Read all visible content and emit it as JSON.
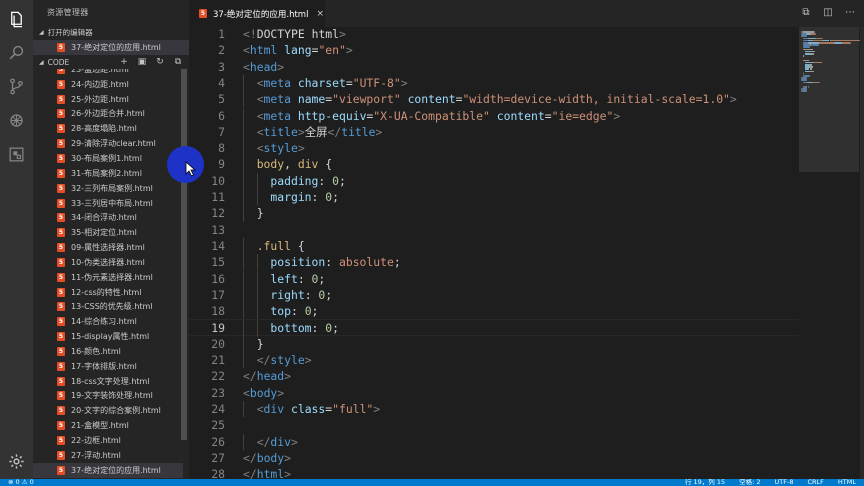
{
  "explorer": {
    "title": "资源管理器",
    "open_editors_label": "打开的编辑器",
    "open_editor_file": "37-绝对定位的应用.html",
    "folder_label": "CODE",
    "files": [
      {
        "name": "23-盒边距.html"
      },
      {
        "name": "24-内边距.html"
      },
      {
        "name": "25-外边距.html"
      },
      {
        "name": "26-外边距合并.html"
      },
      {
        "name": "28-高度塌陷.html"
      },
      {
        "name": "29-清除浮动clear.html"
      },
      {
        "name": "30-布局案例1.html"
      },
      {
        "name": "31-布局案例2.html"
      },
      {
        "name": "32-三列布局案例.html"
      },
      {
        "name": "33-三列居中布局.html"
      },
      {
        "name": "34-闭合浮动.html"
      },
      {
        "name": "35-相对定位.html"
      },
      {
        "name": "09-属性选择器.html"
      },
      {
        "name": "10-伪类选择器.html"
      },
      {
        "name": "11-伪元素选择器.html"
      },
      {
        "name": "12-css的特性.html"
      },
      {
        "name": "13-CSS的优先级.html"
      },
      {
        "name": "14-综合练习.html"
      },
      {
        "name": "15-display属性.html"
      },
      {
        "name": "16-颜色.html"
      },
      {
        "name": "17-字体排版.html"
      },
      {
        "name": "18-css文字处理.html"
      },
      {
        "name": "19-文字装饰处理.html"
      },
      {
        "name": "20-文字的综合案例.html"
      },
      {
        "name": "21-盒模型.html"
      },
      {
        "name": "22-边框.html"
      },
      {
        "name": "27-浮动.html"
      },
      {
        "name": "37-绝对定位的应用.html"
      }
    ],
    "active_file_index": 27
  },
  "tab": {
    "badge": "5",
    "label": "37-绝对定位的应用.html",
    "close": "×"
  },
  "editor": {
    "current_line": 19,
    "lines": [
      {
        "n": "1",
        "indent": 0,
        "tokens": [
          [
            "t-gray",
            "<!"
          ],
          [
            "t-white",
            "DOCTYPE html"
          ],
          [
            "t-gray",
            ">"
          ]
        ]
      },
      {
        "n": "2",
        "indent": 0,
        "tokens": [
          [
            "t-gray",
            "<"
          ],
          [
            "t-blue",
            "html"
          ],
          [
            "t-white",
            " "
          ],
          [
            "t-attr",
            "lang"
          ],
          [
            "t-white",
            "="
          ],
          [
            "t-str",
            "\"en\""
          ],
          [
            "t-gray",
            ">"
          ]
        ]
      },
      {
        "n": "3",
        "indent": 0,
        "tokens": [
          [
            "t-gray",
            "<"
          ],
          [
            "t-blue",
            "head"
          ],
          [
            "t-gray",
            ">"
          ]
        ]
      },
      {
        "n": "4",
        "indent": 1,
        "tokens": [
          [
            "t-gray",
            "<"
          ],
          [
            "t-blue",
            "meta"
          ],
          [
            "t-white",
            " "
          ],
          [
            "t-attr",
            "charset"
          ],
          [
            "t-white",
            "="
          ],
          [
            "t-str",
            "\"UTF-8\""
          ],
          [
            "t-gray",
            ">"
          ]
        ]
      },
      {
        "n": "5",
        "indent": 1,
        "tokens": [
          [
            "t-gray",
            "<"
          ],
          [
            "t-blue",
            "meta"
          ],
          [
            "t-white",
            " "
          ],
          [
            "t-attr",
            "name"
          ],
          [
            "t-white",
            "="
          ],
          [
            "t-str",
            "\"viewport\""
          ],
          [
            "t-white",
            " "
          ],
          [
            "t-attr",
            "content"
          ],
          [
            "t-white",
            "="
          ],
          [
            "t-str",
            "\"width=device-width, initial-scale=1.0\""
          ],
          [
            "t-gray",
            ">"
          ]
        ]
      },
      {
        "n": "6",
        "indent": 1,
        "tokens": [
          [
            "t-gray",
            "<"
          ],
          [
            "t-blue",
            "meta"
          ],
          [
            "t-white",
            " "
          ],
          [
            "t-attr",
            "http-equiv"
          ],
          [
            "t-white",
            "="
          ],
          [
            "t-str",
            "\"X-UA-Compatible\""
          ],
          [
            "t-white",
            " "
          ],
          [
            "t-attr",
            "content"
          ],
          [
            "t-white",
            "="
          ],
          [
            "t-str",
            "\"ie=edge\""
          ],
          [
            "t-gray",
            ">"
          ]
        ]
      },
      {
        "n": "7",
        "indent": 1,
        "tokens": [
          [
            "t-gray",
            "<"
          ],
          [
            "t-blue",
            "title"
          ],
          [
            "t-gray",
            ">"
          ],
          [
            "t-white",
            "全屏"
          ],
          [
            "t-gray",
            "</"
          ],
          [
            "t-blue",
            "title"
          ],
          [
            "t-gray",
            ">"
          ]
        ]
      },
      {
        "n": "8",
        "indent": 1,
        "tokens": [
          [
            "t-gray",
            "<"
          ],
          [
            "t-blue",
            "style"
          ],
          [
            "t-gray",
            ">"
          ]
        ]
      },
      {
        "n": "9",
        "indent": 1,
        "tokens": [
          [
            "t-sel",
            "body"
          ],
          [
            "t-white",
            ", "
          ],
          [
            "t-sel",
            "div"
          ],
          [
            "t-white",
            " {"
          ]
        ]
      },
      {
        "n": "10",
        "indent": 2,
        "tokens": [
          [
            "t-attr",
            "padding"
          ],
          [
            "t-white",
            ": "
          ],
          [
            "t-num",
            "0"
          ],
          [
            "t-white",
            ";"
          ]
        ]
      },
      {
        "n": "11",
        "indent": 2,
        "tokens": [
          [
            "t-attr",
            "margin"
          ],
          [
            "t-white",
            ": "
          ],
          [
            "t-num",
            "0"
          ],
          [
            "t-white",
            ";"
          ]
        ]
      },
      {
        "n": "12",
        "indent": 1,
        "tokens": [
          [
            "t-white",
            "}"
          ]
        ]
      },
      {
        "n": "13",
        "indent": 0,
        "tokens": []
      },
      {
        "n": "14",
        "indent": 1,
        "tokens": [
          [
            "t-sel",
            ".full"
          ],
          [
            "t-white",
            " {"
          ]
        ]
      },
      {
        "n": "15",
        "indent": 2,
        "tokens": [
          [
            "t-attr",
            "position"
          ],
          [
            "t-white",
            ": "
          ],
          [
            "t-str",
            "absolute"
          ],
          [
            "t-white",
            ";"
          ]
        ]
      },
      {
        "n": "16",
        "indent": 2,
        "tokens": [
          [
            "t-attr",
            "left"
          ],
          [
            "t-white",
            ": "
          ],
          [
            "t-num",
            "0"
          ],
          [
            "t-white",
            ";"
          ]
        ]
      },
      {
        "n": "17",
        "indent": 2,
        "tokens": [
          [
            "t-attr",
            "right"
          ],
          [
            "t-white",
            ": "
          ],
          [
            "t-num",
            "0"
          ],
          [
            "t-white",
            ";"
          ]
        ]
      },
      {
        "n": "18",
        "indent": 2,
        "tokens": [
          [
            "t-attr",
            "top"
          ],
          [
            "t-white",
            ": "
          ],
          [
            "t-num",
            "0"
          ],
          [
            "t-white",
            ";"
          ]
        ]
      },
      {
        "n": "19",
        "indent": 2,
        "tokens": [
          [
            "t-attr",
            "bottom"
          ],
          [
            "t-white",
            ": "
          ],
          [
            "t-num",
            "0"
          ],
          [
            "t-white",
            ";"
          ]
        ]
      },
      {
        "n": "20",
        "indent": 1,
        "tokens": [
          [
            "t-white",
            "}"
          ]
        ]
      },
      {
        "n": "21",
        "indent": 1,
        "tokens": [
          [
            "t-gray",
            "</"
          ],
          [
            "t-blue",
            "style"
          ],
          [
            "t-gray",
            ">"
          ]
        ]
      },
      {
        "n": "22",
        "indent": 0,
        "tokens": [
          [
            "t-gray",
            "</"
          ],
          [
            "t-blue",
            "head"
          ],
          [
            "t-gray",
            ">"
          ]
        ]
      },
      {
        "n": "23",
        "indent": 0,
        "tokens": [
          [
            "t-gray",
            "<"
          ],
          [
            "t-blue",
            "body"
          ],
          [
            "t-gray",
            ">"
          ]
        ]
      },
      {
        "n": "24",
        "indent": 1,
        "tokens": [
          [
            "t-gray",
            "<"
          ],
          [
            "t-blue",
            "div"
          ],
          [
            "t-white",
            " "
          ],
          [
            "t-attr",
            "class"
          ],
          [
            "t-white",
            "="
          ],
          [
            "t-str",
            "\"full\""
          ],
          [
            "t-gray",
            ">"
          ]
        ]
      },
      {
        "n": "25",
        "indent": 0,
        "tokens": []
      },
      {
        "n": "26",
        "indent": 1,
        "tokens": [
          [
            "t-gray",
            "</"
          ],
          [
            "t-blue",
            "div"
          ],
          [
            "t-gray",
            ">"
          ]
        ]
      },
      {
        "n": "27",
        "indent": 0,
        "tokens": [
          [
            "t-gray",
            "</"
          ],
          [
            "t-blue",
            "body"
          ],
          [
            "t-gray",
            ">"
          ]
        ]
      },
      {
        "n": "28",
        "indent": 0,
        "tokens": [
          [
            "t-gray",
            "</"
          ],
          [
            "t-blue",
            "html"
          ],
          [
            "t-gray",
            ">"
          ]
        ]
      }
    ]
  },
  "statusbar": {
    "left": "⊗ 0  ⚠ 0",
    "position": "行 19，列 15",
    "spaces": "空格: 2",
    "encoding": "UTF-8",
    "eol": "CRLF",
    "language": "HTML"
  },
  "colors": {
    "activity_bar": "#333333",
    "sidebar": "#252526",
    "editor": "#1e1e1e",
    "statusbar": "#007acc",
    "html_icon": "#e44d26",
    "cursor_highlight": "#1e32c8"
  }
}
